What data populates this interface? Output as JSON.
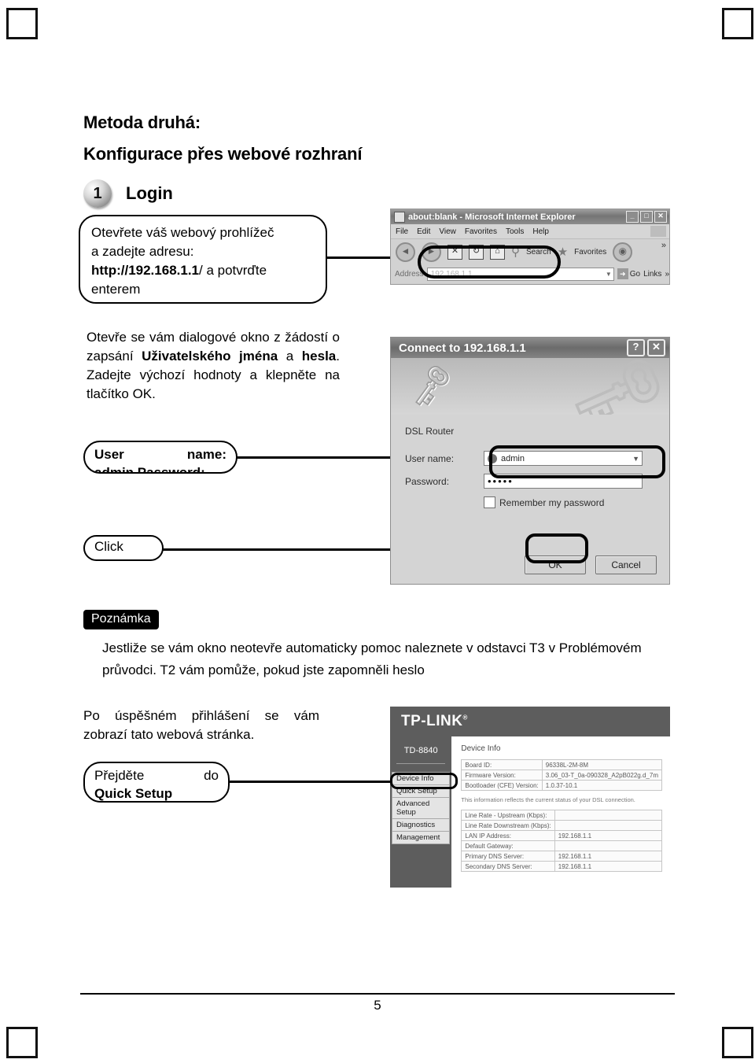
{
  "page": {
    "number": "5"
  },
  "headings": {
    "method": "Metoda druhá:",
    "config": "Konfigurace přes webové rozhraní"
  },
  "step1": {
    "badge": "1",
    "title": "Login"
  },
  "callouts": {
    "address": {
      "line1": "Otevřete váš webový prohlížeč",
      "line2": "a zadejte adresu:",
      "url": "http://192.168.1.1",
      "line3_rest": "/ a potvrďte",
      "line4": "enterem"
    },
    "username": {
      "word1": "User",
      "word2": "name:",
      "line2": "admin Password:"
    },
    "click": {
      "label": "Click"
    },
    "quick": {
      "word1": "Přejděte",
      "word2": "do",
      "line2": "Quick Setup"
    }
  },
  "paragraphs": {
    "dialog_1": "Otevře se vám dialogové okno z žádostí o zapsání ",
    "dialog_bold1": "Uživatelského jména",
    "dialog_2": " a ",
    "dialog_bold2": "hesla",
    "dialog_3": ". Zadejte výchozí hodnoty a klepněte na tlačítko OK.",
    "success": "Po úspěšném přihlášení se vám zobrazí tato webová stránka."
  },
  "note": {
    "tag": "Poznámka",
    "body": "Jestliže se vám okno neotevře automaticky pomoc naleznete v odstavci T3 v Problémovém průvodci. T2 vám pomůže, pokud jste zapomněli heslo"
  },
  "ie_window": {
    "title": "about:blank - Microsoft Internet Explorer",
    "window_buttons": [
      "_",
      "□",
      "✕"
    ],
    "menus": [
      "File",
      "Edit",
      "View",
      "Favorites",
      "Tools",
      "Help"
    ],
    "toolbar": {
      "back": "◄",
      "forward": "►",
      "stop": "✕",
      "refresh": "↻",
      "home": "⌂",
      "search_icon": "search-icon",
      "search_label": "Search",
      "favorites_label": "Favorites",
      "media_icon": "media-icon",
      "overflow": "»"
    },
    "address": {
      "label": "Address",
      "value": "192.168.1.1",
      "dropdown": "▼"
    },
    "go_label": "Go",
    "links_label": "Links",
    "links_overflow": "»"
  },
  "connect_dialog": {
    "title": "Connect to 192.168.1.1",
    "help_button": "?",
    "close_button": "✕",
    "realm": "DSL Router",
    "username_label": "User name:",
    "username_value": "admin",
    "password_label": "Password:",
    "password_value": "•••••",
    "remember_label": "Remember my password",
    "ok_label": "OK",
    "cancel_label": "Cancel"
  },
  "router_page": {
    "brand": "TP-LINK",
    "brand_mark": "®",
    "model": "TD-8840",
    "menu": [
      "Device Info",
      "Quick Setup",
      "Advanced Setup",
      "Diagnostics",
      "Management"
    ],
    "content_title": "Device Info",
    "info_rows": [
      {
        "key": "Board ID:",
        "value": "96338L-2M-8M"
      },
      {
        "key": "Firmware Version:",
        "value": "3.06_03-T_0a-090328_A2pB022g.d_7m"
      },
      {
        "key": "Bootloader (CFE) Version:",
        "value": "1.0.37-10.1"
      }
    ],
    "note": "This information reflects the current status of your DSL connection.",
    "status_rows": [
      {
        "key": "Line Rate - Upstream (Kbps):",
        "value": ""
      },
      {
        "key": "Line Rate   Downstream (Kbps):",
        "value": ""
      },
      {
        "key": "LAN IP Address:",
        "value": "192.168.1.1"
      },
      {
        "key": "Default Gateway:",
        "value": ""
      },
      {
        "key": "Primary DNS Server:",
        "value": "192.168.1.1"
      },
      {
        "key": "Secondary DNS Server:",
        "value": "192.168.1.1"
      }
    ]
  },
  "colors": {
    "ink": "#000000",
    "paper": "#ffffff",
    "chrome": "#5d5d5d"
  }
}
